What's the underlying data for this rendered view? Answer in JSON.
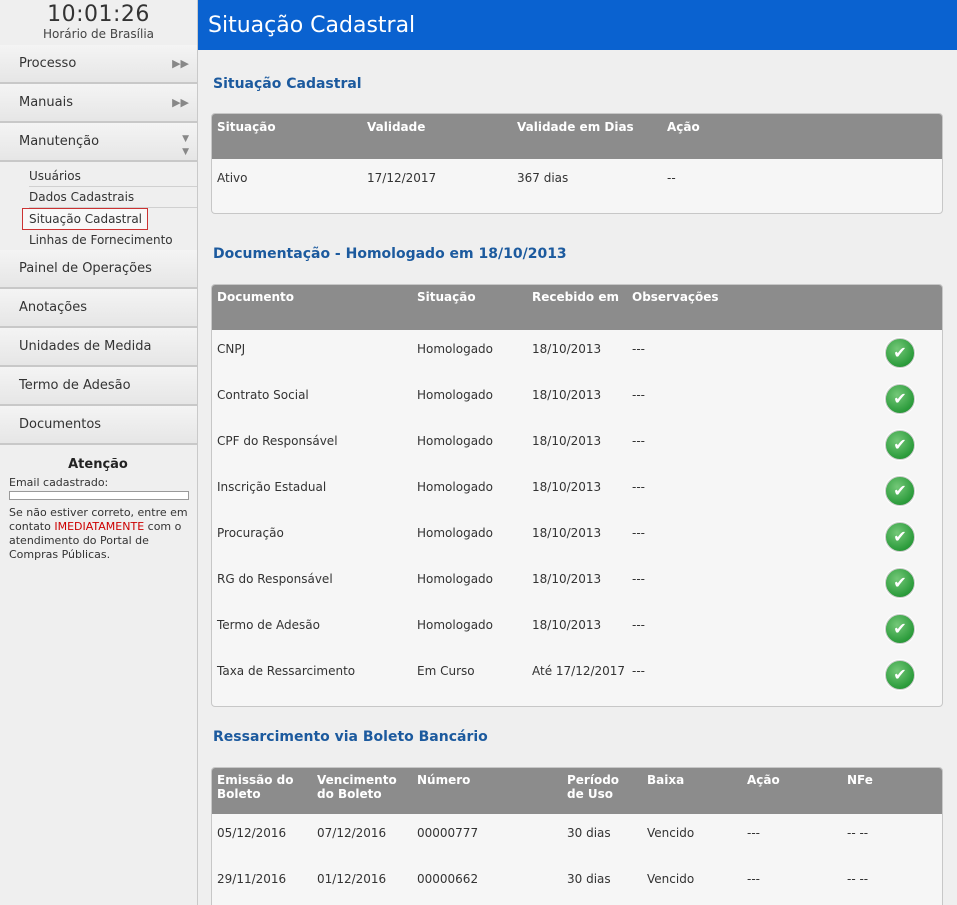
{
  "clock": {
    "time": "10:01:26",
    "tz": "Horário de Brasília"
  },
  "menu": {
    "processo": "Processo",
    "manuais": "Manuais",
    "manutencao": "Manutenção",
    "sub": [
      "Usuários",
      "Dados Cadastrais",
      "Situação Cadastral",
      "Linhas de Fornecimento"
    ],
    "painel": "Painel de Operações",
    "anotacoes": "Anotações",
    "unidades": "Unidades de Medida",
    "termo": "Termo de Adesão",
    "documentos": "Documentos"
  },
  "attention": {
    "title": "Atenção",
    "email_label": "Email cadastrado:",
    "notice_1": "Se não estiver correto, entre em contato ",
    "notice_hl": "IMEDIATAMENTE",
    "notice_2": " com o atendimento do Portal de Compras Públicas."
  },
  "header": {
    "title": "Situação Cadastral"
  },
  "situacao": {
    "title": "Situação Cadastral",
    "columns": [
      "Situação",
      "Validade",
      "Validade em Dias",
      "Ação"
    ],
    "row": [
      "Ativo",
      "17/12/2017",
      "367 dias",
      "--"
    ]
  },
  "documentacao": {
    "title": "Documentação - Homologado em 18/10/2013",
    "columns": [
      "Documento",
      "Situação",
      "Recebido em",
      "Observações"
    ],
    "rows": [
      [
        "CNPJ",
        "Homologado",
        "18/10/2013",
        "---"
      ],
      [
        "Contrato Social",
        "Homologado",
        "18/10/2013",
        "---"
      ],
      [
        "CPF do Responsável",
        "Homologado",
        "18/10/2013",
        "---"
      ],
      [
        "Inscrição Estadual",
        "Homologado",
        "18/10/2013",
        "---"
      ],
      [
        "Procuração",
        "Homologado",
        "18/10/2013",
        "---"
      ],
      [
        "RG do Responsável",
        "Homologado",
        "18/10/2013",
        "---"
      ],
      [
        "Termo de Adesão",
        "Homologado",
        "18/10/2013",
        "---"
      ],
      [
        "Taxa de Ressarcimento",
        "Em Curso",
        "Até 17/12/2017",
        "---"
      ]
    ]
  },
  "boleto": {
    "title": "Ressarcimento via Boleto Bancário",
    "columns": [
      "Emissão do\nBoleto",
      "Vencimento\ndo Boleto",
      "Número",
      "Período\nde Uso",
      "Baixa",
      "Ação",
      "NFe"
    ],
    "rows": [
      [
        "05/12/2016",
        "07/12/2016",
        "00000777",
        "30 dias",
        "Vencido",
        "---",
        "-- --"
      ],
      [
        "29/11/2016",
        "01/12/2016",
        "00000662",
        "30 dias",
        "Vencido",
        "---",
        "-- --"
      ]
    ]
  }
}
